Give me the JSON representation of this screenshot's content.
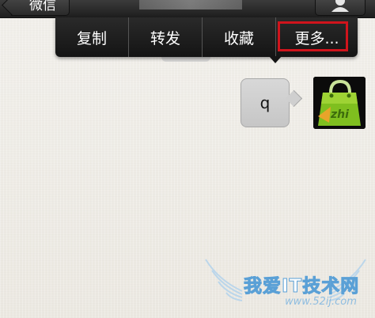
{
  "navbar": {
    "back_label": "微信",
    "profile_icon": "person-icon"
  },
  "context_menu": {
    "items": [
      {
        "label": "复制"
      },
      {
        "label": "转发"
      },
      {
        "label": "收藏"
      },
      {
        "label": "更多..."
      }
    ],
    "highlight_color": "#d0141c"
  },
  "message": {
    "text": "q",
    "bubble_color": "#cfcfcf"
  },
  "avatar": {
    "icon": "green-shopping-bag-icon",
    "text": "zhi"
  },
  "watermark": {
    "title": "我爱IT技术网",
    "url": "www.52ij.com"
  }
}
